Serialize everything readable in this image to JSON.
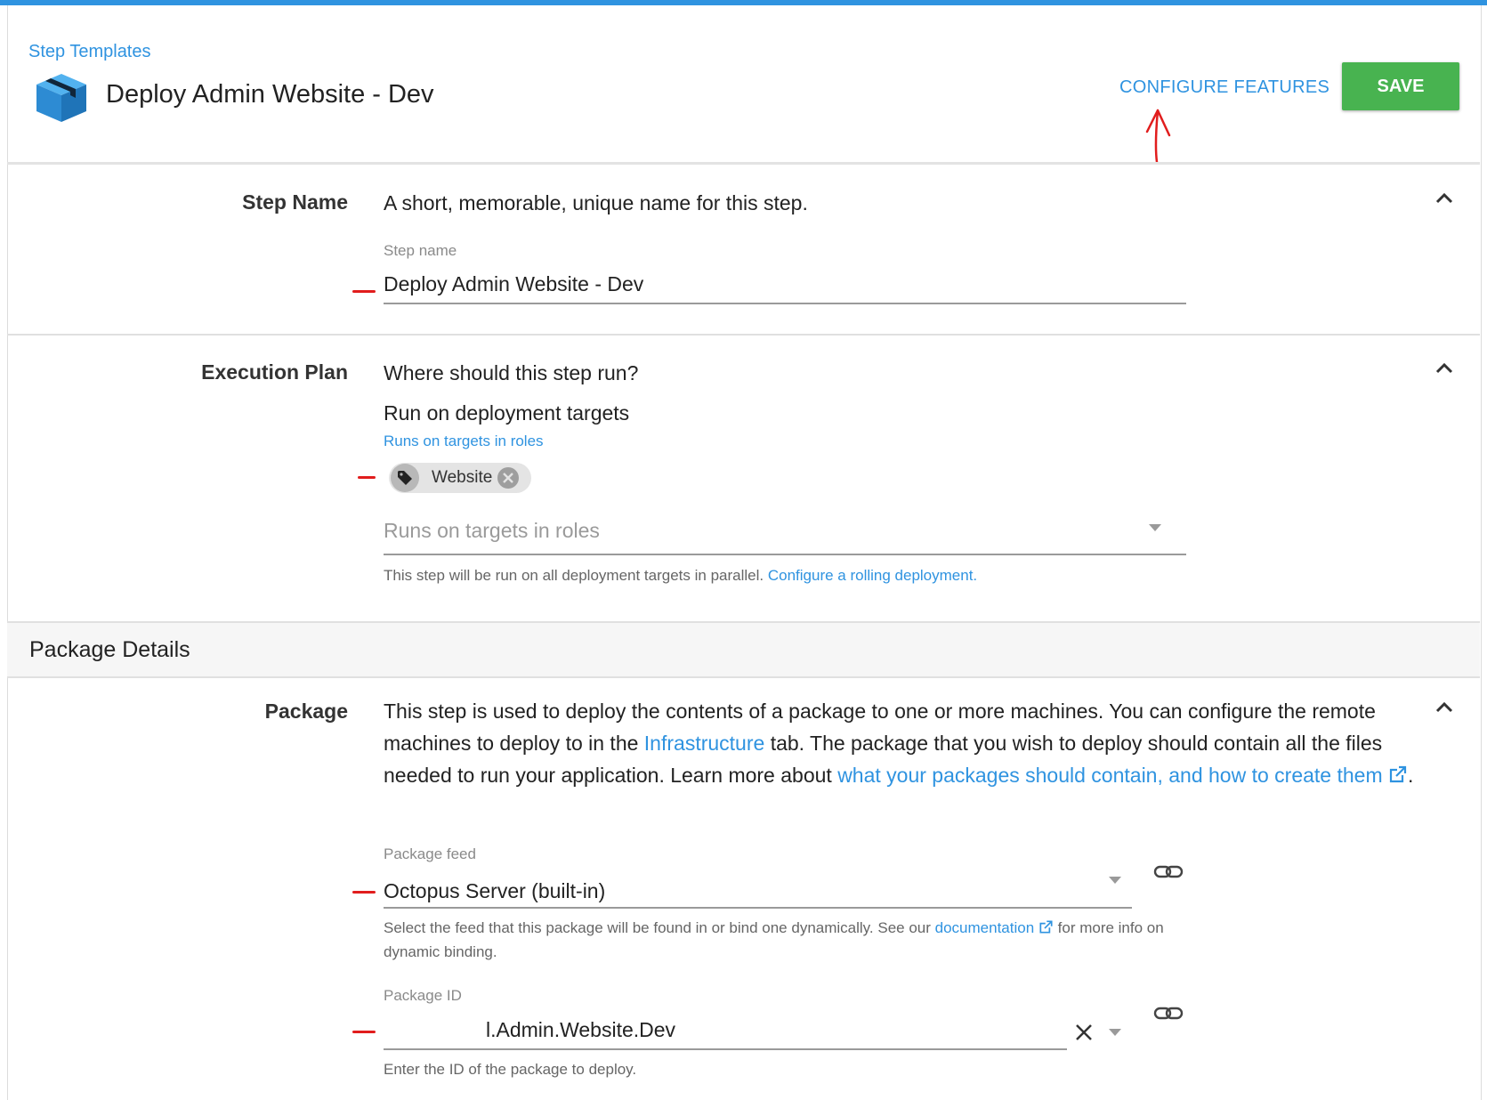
{
  "header": {
    "breadcrumb": "Step Templates",
    "title": "Deploy Admin Website - Dev",
    "configure_features": "CONFIGURE FEATURES",
    "save": "SAVE"
  },
  "step_name": {
    "label": "Step Name",
    "description": "A short, memorable, unique name for this step.",
    "field_label": "Step name",
    "value": "Deploy Admin Website - Dev"
  },
  "execution_plan": {
    "label": "Execution Plan",
    "description": "Where should this step run?",
    "mode": "Run on deployment targets",
    "roles_link": "Runs on targets in roles",
    "chip": "Website",
    "roles_placeholder": "Runs on targets in roles",
    "help_text": "This step will be run on all deployment targets in parallel.",
    "help_link": "Configure a rolling deployment."
  },
  "package_details": {
    "title": "Package Details",
    "label": "Package",
    "para_1": "This step is used to deploy the contents of a package to one or more machines. You can configure the remote machines to deploy to in the",
    "infrastructure_link": "Infrastructure",
    "para_2": "tab. The package that you wish to deploy should contain all the files needed to run your application. Learn more about",
    "learn_link": "what your packages should contain, and how to create them",
    "para_end": ".",
    "feed_label": "Package feed",
    "feed_value": "Octopus Server (built-in)",
    "feed_help_1": "Select the feed that this package will be found in or bind one dynamically. See our",
    "feed_help_link": "documentation",
    "feed_help_2": "for more info on dynamic binding.",
    "id_label": "Package ID",
    "id_value": "l.Admin.Website.Dev",
    "id_help": "Enter the ID of the package to deploy."
  },
  "colors": {
    "accent": "#2f93e0",
    "save": "#48b350",
    "annotation": "#e11d1d"
  }
}
